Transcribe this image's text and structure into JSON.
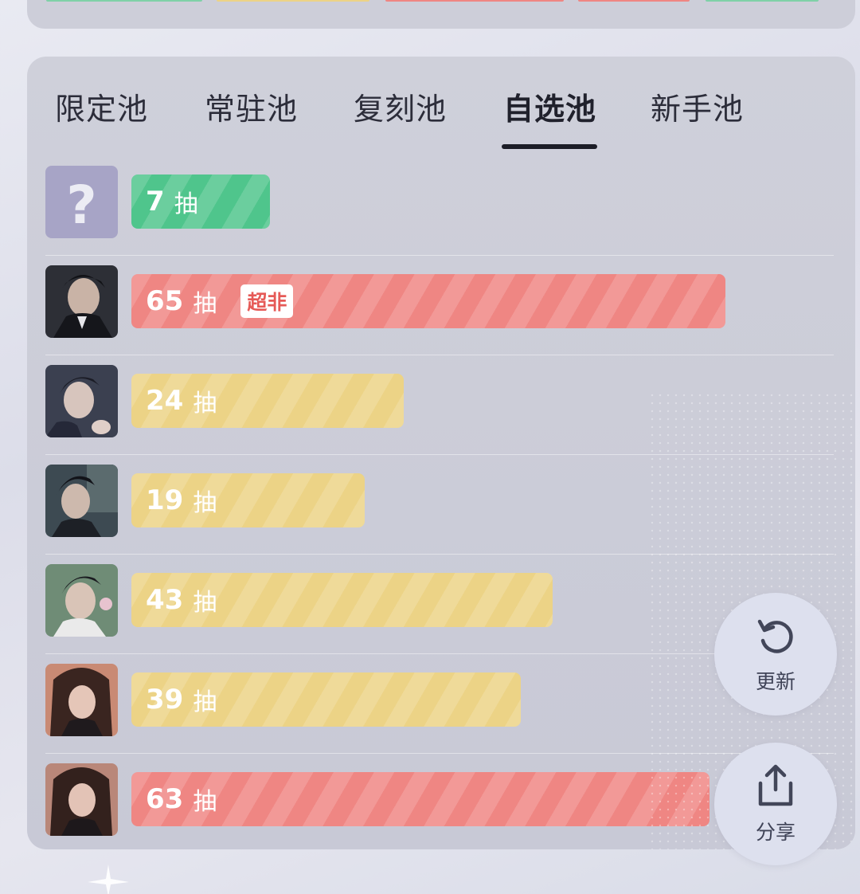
{
  "tabs": [
    {
      "label": "限定池",
      "active": false
    },
    {
      "label": "常驻池",
      "active": false
    },
    {
      "label": "复刻池",
      "active": false
    },
    {
      "label": "自选池",
      "active": true
    },
    {
      "label": "新手池",
      "active": false
    }
  ],
  "rows": [
    {
      "avatar": "unknown-question-mark",
      "pulls": "7",
      "unit": "抽",
      "color": "#4fc58c",
      "badge": ""
    },
    {
      "avatar": "character-portrait",
      "pulls": "65",
      "unit": "抽",
      "color": "#ef8683",
      "badge": "超非"
    },
    {
      "avatar": "character-portrait",
      "pulls": "24",
      "unit": "抽",
      "color": "#ecd386",
      "badge": ""
    },
    {
      "avatar": "character-portrait",
      "pulls": "19",
      "unit": "抽",
      "color": "#ecd386",
      "badge": ""
    },
    {
      "avatar": "character-portrait",
      "pulls": "43",
      "unit": "抽",
      "color": "#ecd386",
      "badge": ""
    },
    {
      "avatar": "character-portrait",
      "pulls": "39",
      "unit": "抽",
      "color": "#ecd386",
      "badge": ""
    },
    {
      "avatar": "character-portrait",
      "pulls": "63",
      "unit": "抽",
      "color": "#ef8683",
      "badge": ""
    }
  ],
  "actions": {
    "refresh_label": "更新",
    "share_label": "分享",
    "refresh_icon": "refresh-icon",
    "share_icon": "share-icon"
  },
  "colors": {
    "green": "#4fc58c",
    "red": "#ef8683",
    "yellow": "#ecd386"
  }
}
